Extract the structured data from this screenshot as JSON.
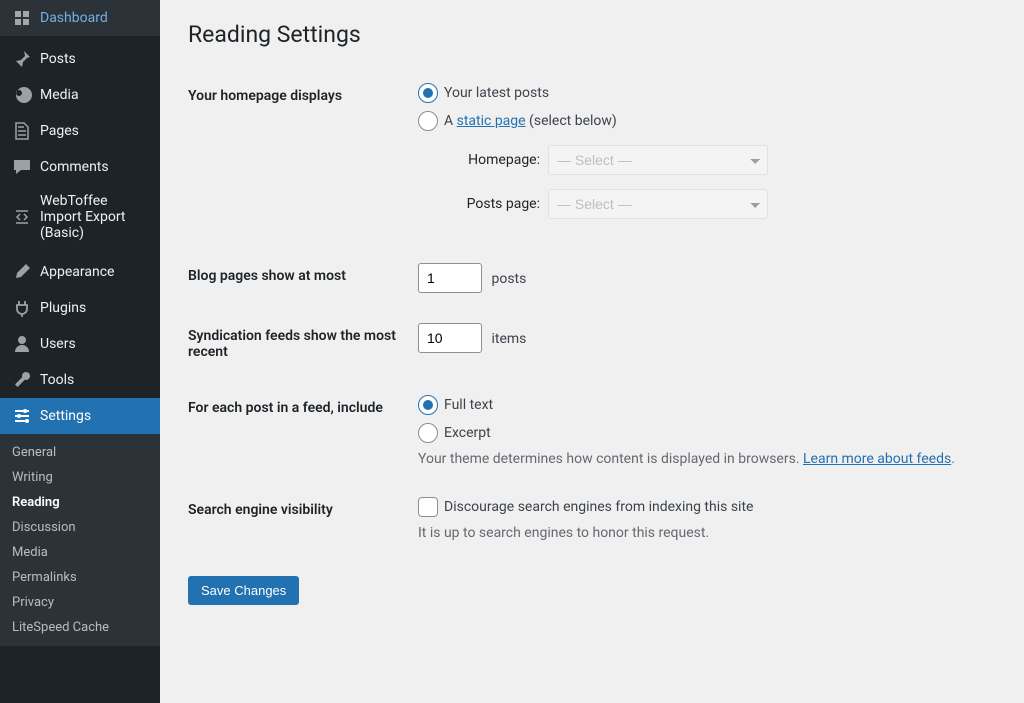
{
  "sidebar": {
    "main": [
      {
        "icon": "dashboard",
        "label": "Dashboard"
      },
      {
        "sep": true
      },
      {
        "icon": "pin",
        "label": "Posts"
      },
      {
        "icon": "media",
        "label": "Media"
      },
      {
        "icon": "page",
        "label": "Pages"
      },
      {
        "icon": "comment",
        "label": "Comments"
      },
      {
        "icon": "import",
        "label": "WebToffee Import Export (Basic)"
      },
      {
        "sep": true
      },
      {
        "icon": "brush",
        "label": "Appearance"
      },
      {
        "icon": "plugin",
        "label": "Plugins"
      },
      {
        "icon": "user",
        "label": "Users"
      },
      {
        "icon": "wrench",
        "label": "Tools"
      },
      {
        "icon": "settings",
        "label": "Settings",
        "active": true
      }
    ],
    "sub": [
      {
        "label": "General"
      },
      {
        "label": "Writing"
      },
      {
        "label": "Reading",
        "current": true
      },
      {
        "label": "Discussion"
      },
      {
        "label": "Media"
      },
      {
        "label": "Permalinks"
      },
      {
        "label": "Privacy"
      },
      {
        "label": "LiteSpeed Cache"
      }
    ]
  },
  "page": {
    "title": "Reading Settings",
    "homepage_displays": {
      "label": "Your homepage displays",
      "opt_latest": "Your latest posts",
      "opt_static_prefix": "A ",
      "opt_static_link": "static page",
      "opt_static_suffix": " (select below)",
      "homepage_label": "Homepage:",
      "postspage_label": "Posts page:",
      "select_placeholder": "— Select —"
    },
    "blog_pages": {
      "label": "Blog pages show at most",
      "value": "1",
      "unit": "posts"
    },
    "syndication": {
      "label": "Syndication feeds show the most recent",
      "value": "10",
      "unit": "items"
    },
    "feed_include": {
      "label": "For each post in a feed, include",
      "opt_full": "Full text",
      "opt_excerpt": "Excerpt",
      "desc_prefix": "Your theme determines how content is displayed in browsers. ",
      "desc_link": "Learn more about feeds"
    },
    "search_visibility": {
      "label": "Search engine visibility",
      "checkbox_label": "Discourage search engines from indexing this site",
      "desc": "It is up to search engines to honor this request."
    },
    "submit_label": "Save Changes"
  }
}
